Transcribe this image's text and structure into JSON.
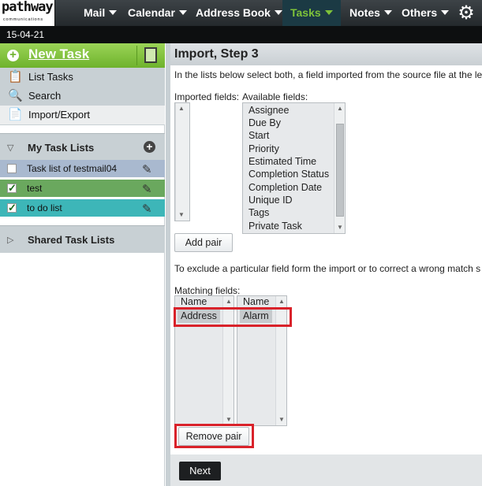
{
  "logo": {
    "word": "pathway",
    "sub": "communications"
  },
  "nav": {
    "items": [
      {
        "label": "Mail"
      },
      {
        "label": "Calendar"
      },
      {
        "label": "Address Book"
      },
      {
        "label": "Tasks"
      },
      {
        "label": "Notes"
      },
      {
        "label": "Others"
      }
    ],
    "active": "Tasks",
    "settings_icon": "gear-icon"
  },
  "date": "15-04-21",
  "sidebar": {
    "new_task": "New Task",
    "menu": [
      {
        "label": "List Tasks",
        "icon": "clipboard-icon"
      },
      {
        "label": "Search",
        "icon": "search-icon"
      },
      {
        "label": "Import/Export",
        "icon": "import-export-icon"
      }
    ],
    "my_task_lists": "My Task Lists",
    "lists": [
      {
        "label": "Task list of testmail04",
        "checked": false,
        "color": "#a9b9cf"
      },
      {
        "label": "test",
        "checked": true,
        "color": "#6aa85e"
      },
      {
        "label": "to do list",
        "checked": true,
        "color": "#3db6b8"
      }
    ],
    "shared_task_lists": "Shared Task Lists"
  },
  "main": {
    "title": "Import, Step 3",
    "instruction": "In the lists below select both, a field imported from the source file at the le",
    "imported_label": "Imported fields:",
    "available_label": "Available fields:",
    "available_fields": [
      "Assignee",
      "Due By",
      "Start",
      "Priority",
      "Estimated Time",
      "Completion Status",
      "Completion Date",
      "Unique ID",
      "Tags",
      "Private Task"
    ],
    "add_pair": "Add pair",
    "exclude_text": "To exclude a particular field form the import or to correct a wrong match s",
    "matching_label": "Matching fields:",
    "left_col_header": "Name",
    "right_col_header": "Name",
    "left_match": "Address",
    "right_match": "Alarm",
    "remove_pair": "Remove pair",
    "next": "Next"
  },
  "colors": {
    "accent_green": "#7ec23a",
    "highlight_red": "#d9222a"
  }
}
